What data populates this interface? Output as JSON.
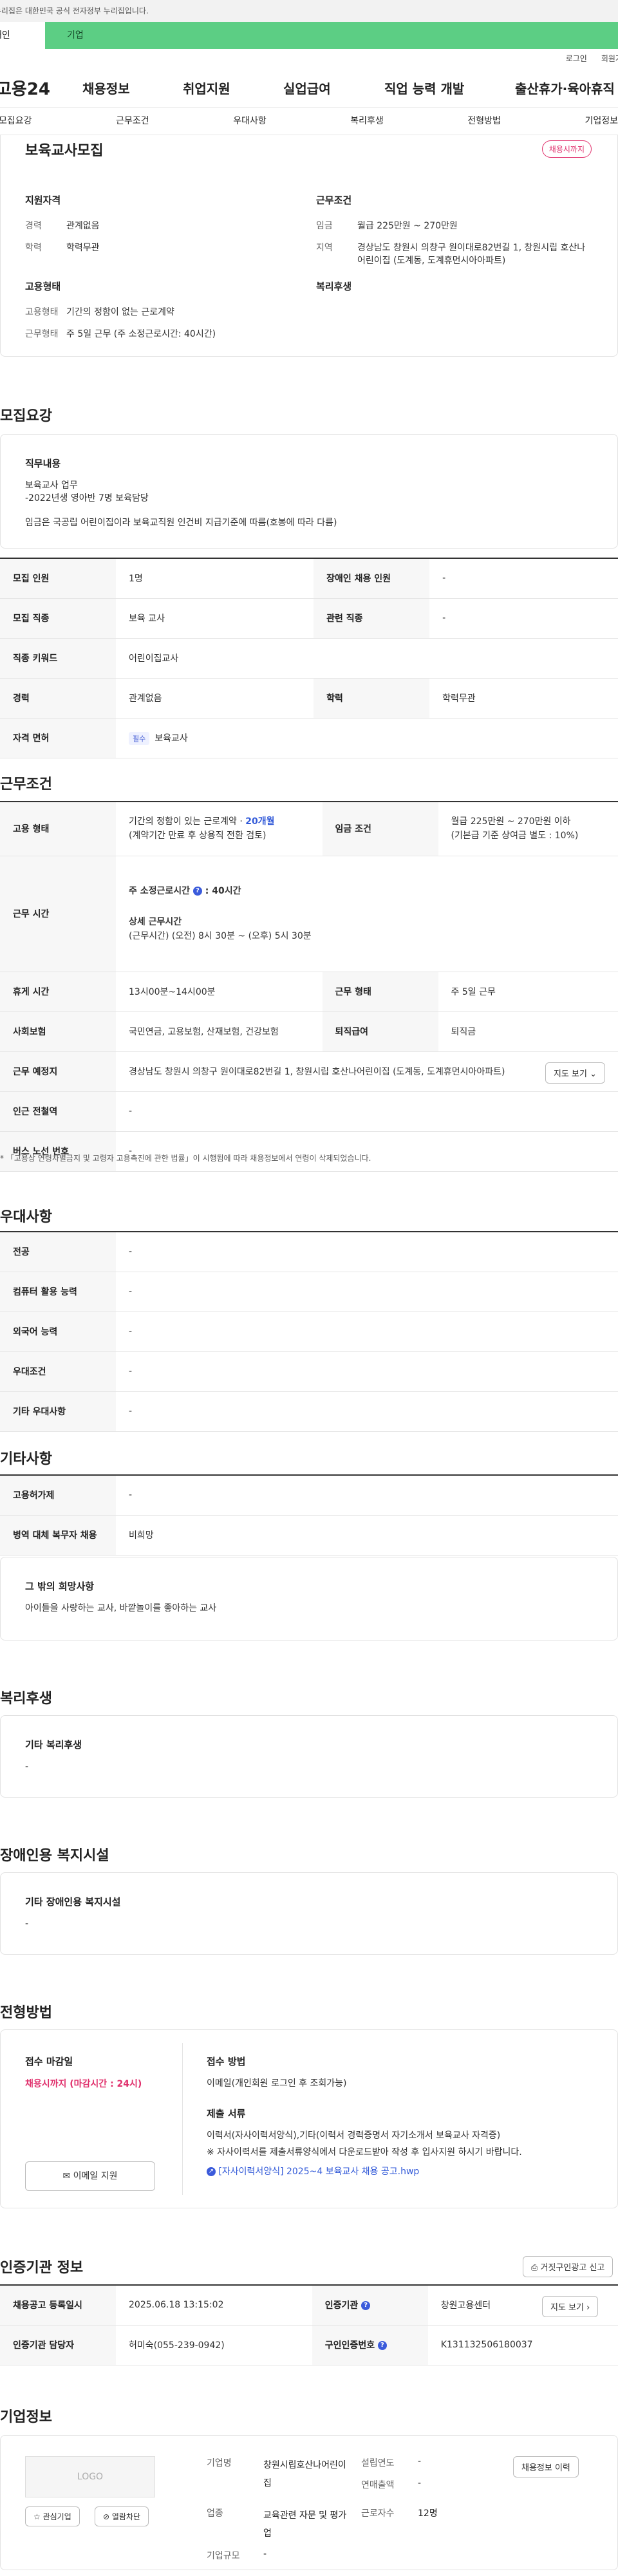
{
  "gov_bar": {
    "text": "이 누리집은 대한민국 공식 전자정부 누리집입니다."
  },
  "tabs": {
    "person": "개인",
    "company": "기업"
  },
  "util": {
    "login": "로그인",
    "signup": "회원가입"
  },
  "gnb": {
    "logo": "고용24",
    "items": [
      "채용정보",
      "취업지원",
      "실업급여",
      "직업 능력 개발",
      "출산휴가·육아휴직"
    ]
  },
  "sub_nav": [
    "모집요강",
    "근무조건",
    "우대사항",
    "복리후생",
    "전형방법",
    "기업정보"
  ],
  "summary": {
    "title": "보육교사모집",
    "badge": "채용시까지",
    "qual": {
      "heading": "지원자격",
      "rows": [
        [
          "경력",
          "관계없음"
        ],
        [
          "학력",
          "학력무관"
        ]
      ]
    },
    "cond": {
      "heading": "근무조건",
      "rows": [
        [
          "임금",
          "월급 225만원 ~ 270만원"
        ],
        [
          "지역",
          "경상남도 창원시 의창구 원이대로82번길 1, 창원시립 호산나어린이집 (도계동, 도계휴먼시아아파트)"
        ]
      ]
    },
    "emp": {
      "heading": "고용형태",
      "rows": [
        [
          "고용형태",
          "기간의 정함이 없는 근로계약"
        ],
        [
          "근무형태",
          "주 5일 근무 (주 소정근로시간: 40시간)"
        ]
      ]
    },
    "welfare": {
      "heading": "복리후생"
    }
  },
  "recruit": {
    "title": "모집요강",
    "duty_heading": "직무내용",
    "duty_lines": [
      "보육교사 업무",
      "-2022년생 영아반 7명 보육담당"
    ],
    "duty_note": "임금은 국공립 어린이집이라 보육교직원 인건비 지급기준에 따름(호봉에 따라 다름)",
    "table": {
      "recruit_count_label": "모집 인원",
      "recruit_count": "1명",
      "disabled_label": "장애인 채용 인원",
      "disabled": "-",
      "job_label": "모집 직종",
      "job": "보육 교사",
      "related_label": "관련 직종",
      "related": "-",
      "keyword_label": "직종 키워드",
      "keyword": "어린이집교사",
      "career_label": "경력",
      "career": "관계없음",
      "edu_label": "학력",
      "edu": "학력무관",
      "license_label": "자격 면허",
      "license_tag": "필수",
      "license": "보육교사"
    }
  },
  "work": {
    "title": "근무조건",
    "emp_type_label": "고용 형태",
    "emp_type": "기간의 정함이 있는 근로계약 · ",
    "emp_months": "20개월",
    "emp_note": "(계약기간 만료 후 상용직 전환 검토)",
    "wage_label": "임금 조건",
    "wage": "월급 225만원 ~ 270만원 이하",
    "wage_note": "(기본급 기준 상여금 별도 : 10%)",
    "hours_label": "근무 시간",
    "weekly_hours": "주 소정근로시간",
    "weekly_hours_value": ": 40시간",
    "detail_heading": "상세 근무시간",
    "detail_hours": "(근무시간) (오전) 8시 30분 ~ (오후) 5시 30분",
    "break_label": "휴게 시간",
    "break": "13시00분~14시00분",
    "work_form_label": "근무 형태",
    "work_form": "주 5일 근무",
    "insurance_label": "사회보험",
    "insurance": "국민연금, 고용보험, 산재보험, 건강보험",
    "severance_label": "퇴직급여",
    "severance": "퇴직금",
    "place_label": "근무 예정지",
    "place": "경상남도 창원시 의창구 원이대로82번길 1, 창원시립 호산나어린이집 (도계동, 도계휴먼시아아파트)",
    "map_button": "지도 보기",
    "subway_label": "인근 전철역",
    "subway": "-",
    "bus_label": "버스 노선 번호",
    "bus": "-",
    "note": "* 「고용상 연령차별금지 및 고령자 고용촉진에 관한 법률」이 시행됨에 따라 채용정보에서 연령이 삭제되었습니다."
  },
  "pref": {
    "title": "우대사항",
    "rows": [
      [
        "전공",
        "-"
      ],
      [
        "컴퓨터 활용 능력",
        "-"
      ],
      [
        "외국어 능력",
        "-"
      ],
      [
        "우대조건",
        "-"
      ],
      [
        "기타 우대사항",
        "-"
      ]
    ]
  },
  "etc": {
    "title": "기타사항",
    "rows": [
      [
        "고용허가제",
        "-"
      ],
      [
        "병역 대체 복무자 채용",
        "비희망"
      ]
    ],
    "wish_heading": "그 밖의 희망사항",
    "wish": "아이들을 사랑하는 교사, 바깥놀이를 좋아하는 교사"
  },
  "welfare": {
    "title": "복리후생",
    "heading": "기타 복리후생",
    "value": "-"
  },
  "disabled_fac": {
    "title": "장애인용 복지시설",
    "heading": "기타 장애인용 복지시설",
    "value": "-"
  },
  "selection": {
    "title": "전형방법",
    "deadline_heading": "접수 마감일",
    "deadline": "채용시까지 (마감시간 : 24시)",
    "apply_button": "이메일 지원",
    "method_heading": "접수 방법",
    "method": "이메일(개인회원 로그인 후 조회가능)",
    "docs_heading": "제출 서류",
    "docs": "이력서(자사이력서양식),기타(이력서 경력증명서 자기소개서 보육교사 자격증)",
    "docs_note": "※ 자사이력서를 제출서류양식에서 다운로드받아 작성 후 입사지원 하시기 바랍니다.",
    "file": "[자사이력서양식] 2025~4 보육교사 채용 공고.hwp"
  },
  "agency": {
    "title": "인증기관 정보",
    "report_button": "거짓구인광고 신고",
    "reg_date_label": "채용공고 등록일시",
    "reg_date": "2025.06.18 13:15:02",
    "org_label": "인증기관",
    "org": "창원고용센터",
    "contact_label": "인증기관 담당자",
    "contact": "허미숙(055-239-0942)",
    "map_button": "지도 보기",
    "id_label": "구인인증번호",
    "id": "K131132506180037"
  },
  "company": {
    "title": "기업정보",
    "logo": "LOGO",
    "fav_button": "관심기업",
    "block_button": "열람차단",
    "name_label": "기업명",
    "name": "창원시립호산나어린이집",
    "year_label": "설립연도",
    "year": "-",
    "sales_label": "연매출액",
    "sales": "-",
    "industry_label": "업종",
    "industry": "교육관련 자문 및 평가업",
    "staff_label": "근로자수",
    "staff": "12명",
    "size_label": "기업규모",
    "size": "-",
    "info_button": "채용정보 이력"
  }
}
